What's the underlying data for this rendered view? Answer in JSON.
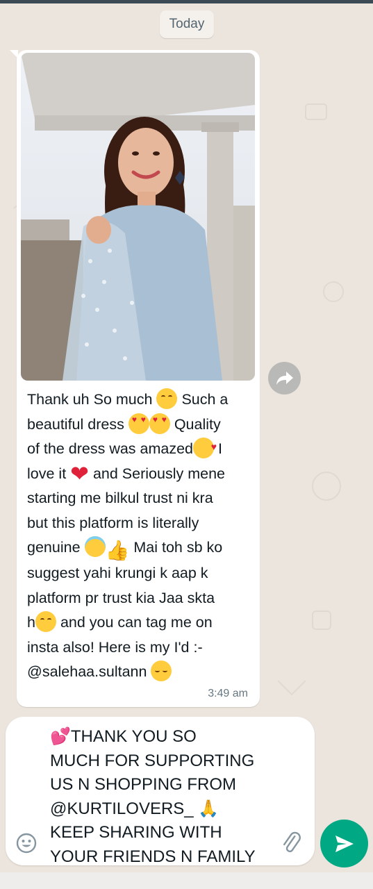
{
  "chat": {
    "date_divider": "Today",
    "incoming": {
      "lines": [
        "Thank uh So much",
        "Such a",
        "beautiful dress",
        "Quality",
        "of the dress was amazed",
        "I",
        "love it",
        "and Seriously mene",
        "starting me bilkul trust ni kra",
        "but this platform is literally",
        "genuine",
        "Mai toh sb ko",
        "suggest yahi krungi k aap k",
        "platform pr trust kia Jaa skta",
        "h",
        "and you can tag me on",
        "insta also! Here is my I'd :-",
        "@salehaa.sultann"
      ],
      "time": "3:49 am"
    }
  },
  "composer": {
    "text": "💕THANK YOU SO\nMUCH FOR SUPPORTING\nUS N SHOPPING FROM\n@KURTILOVERS_ 🙏\nKEEP SHARING WITH\nYOUR FRIENDS N FAMILY"
  },
  "icons": {
    "forward": "forward-arrow-icon",
    "emoji": "emoji-smiley-icon",
    "attach": "paperclip-icon",
    "send": "send-icon"
  },
  "colors": {
    "chat_bg": "#ece5dd",
    "bubble_bg": "#ffffff",
    "send_button": "#00a884",
    "timestamp": "#667781"
  }
}
